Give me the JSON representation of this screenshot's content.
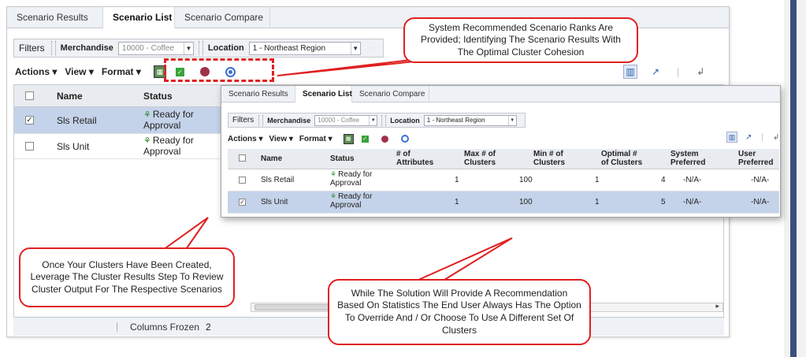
{
  "tabs": [
    "Scenario Results",
    "Scenario List",
    "Scenario Compare"
  ],
  "filters": {
    "label": "Filters",
    "merchandise_label": "Merchandise",
    "merchandise_value": "10000 - Coffee",
    "location_label": "Location",
    "location_value": "1 - Northeast Region"
  },
  "toolbar": {
    "actions": "Actions",
    "view": "View",
    "format": "Format"
  },
  "back_grid": {
    "headers": {
      "name": "Name",
      "status": "Status"
    },
    "rows": [
      {
        "name": "Sls Retail",
        "status_line1": "Ready for",
        "status_line2": "Approval",
        "checked": true
      },
      {
        "name": "Sls Unit",
        "status_line1": "Ready for",
        "status_line2": "Approval",
        "checked": false
      }
    ]
  },
  "footer": {
    "columns_frozen_label": "Columns Frozen",
    "columns_frozen_value": "2"
  },
  "front_grid": {
    "headers": {
      "name": "Name",
      "status": "Status",
      "attributes_1": "# of",
      "attributes_2": "Attributes",
      "max_1": "Max # of",
      "max_2": "Clusters",
      "min_1": "Min # of",
      "min_2": "Clusters",
      "optimal_1": "Optimal #",
      "optimal_2": "of Clusters",
      "system_1": "System",
      "system_2": "Preferred",
      "user_1": "User",
      "user_2": "Preferred"
    },
    "rows": [
      {
        "name": "Sls Retail",
        "status_line1": "Ready for",
        "status_line2": "Approval",
        "attributes": "1",
        "max": "100",
        "min": "1",
        "optimal": "4",
        "system": "-N/A-",
        "user": "-N/A-",
        "checked": false
      },
      {
        "name": "Sls Unit",
        "status_line1": "Ready for",
        "status_line2": "Approval",
        "attributes": "1",
        "max": "100",
        "min": "1",
        "optimal": "5",
        "system": "-N/A-",
        "user": "-N/A-",
        "checked": true
      }
    ]
  },
  "callouts": {
    "top": "System Recommended Scenario Ranks Are Provided; Identifying The Scenario Results With The Optimal Cluster Cohesion",
    "left": "Once Your Clusters Have Been Created, Leverage The Cluster Results Step To Review Cluster Output For The Respective Scenarios",
    "bottom": "While The Solution Will Provide A Recommendation Based On Statistics The End User Always Has The Option To Override And / Or Choose To Use A Different Set Of Clusters"
  },
  "colors": {
    "callout_border": "#e02020",
    "selected_row": "#c5d3ea",
    "accent_bar": "#3b4f7d"
  },
  "icons": [
    "export-icon",
    "approve-icon",
    "rank-icon",
    "cluster-icon",
    "view-columns-icon",
    "detach-icon",
    "wrap-icon"
  ]
}
